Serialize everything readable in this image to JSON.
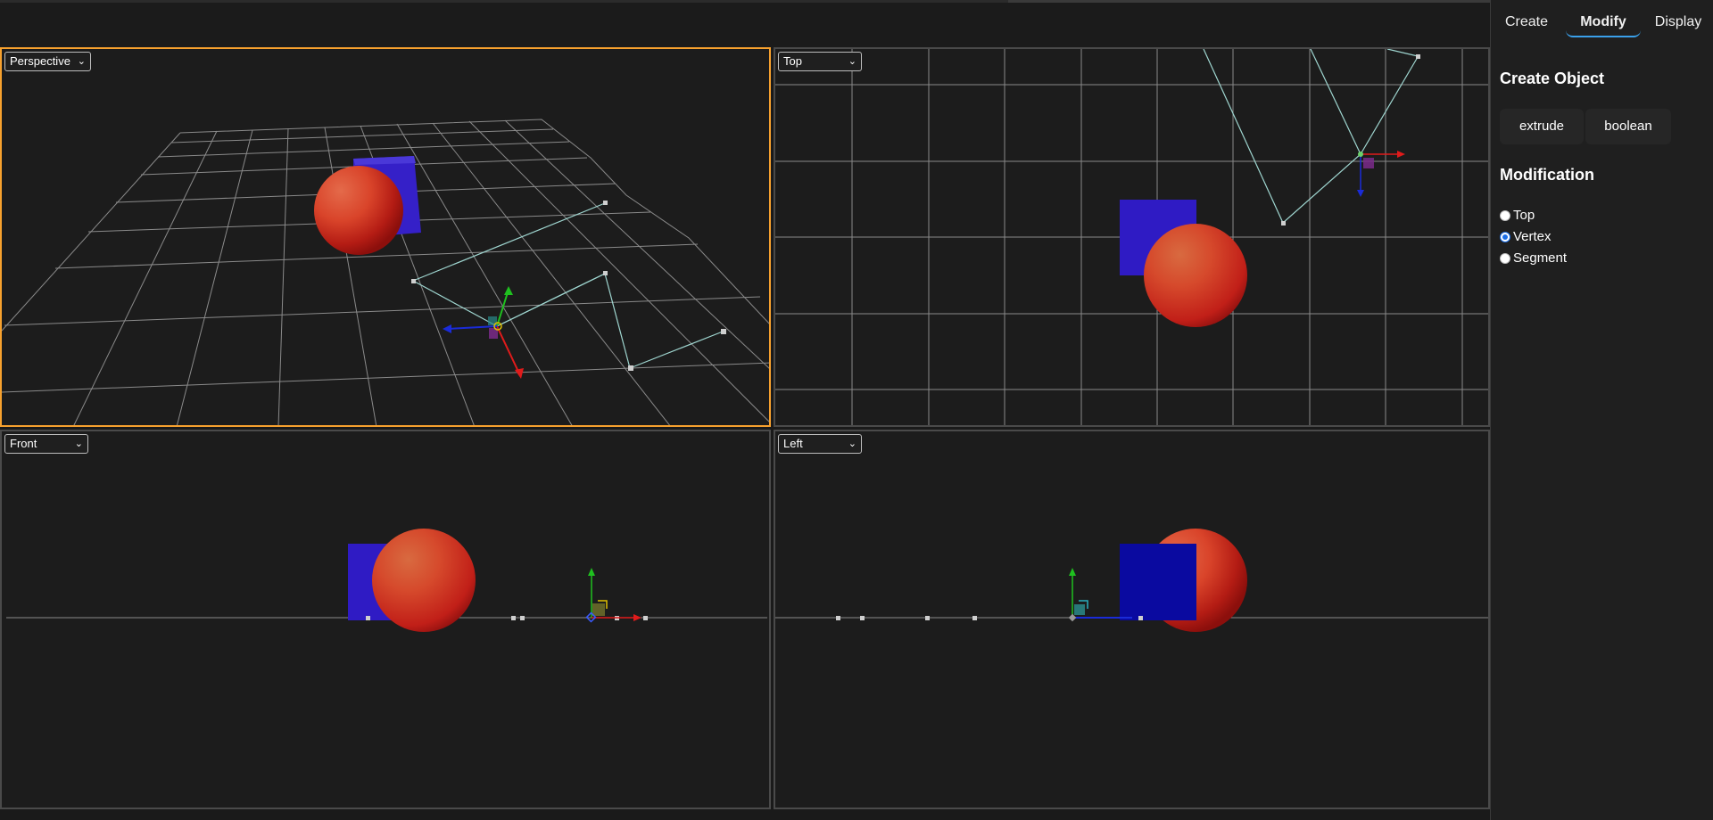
{
  "viewports": {
    "perspective": {
      "label": "Perspective"
    },
    "top": {
      "label": "Top"
    },
    "front": {
      "label": "Front"
    },
    "left": {
      "label": "Left"
    }
  },
  "panel": {
    "tabs": [
      {
        "label": "Create",
        "active": false
      },
      {
        "label": "Modify",
        "active": true
      },
      {
        "label": "Display",
        "active": false
      }
    ],
    "create_object": {
      "title": "Create Object",
      "buttons": [
        "extrude",
        "boolean"
      ]
    },
    "modification": {
      "title": "Modification",
      "options": [
        {
          "label": "Top",
          "selected": false
        },
        {
          "label": "Vertex",
          "selected": true
        },
        {
          "label": "Segment",
          "selected": false
        }
      ]
    }
  },
  "colors": {
    "active_viewport_border": "#f7a12e",
    "active_tab_underline": "#3aa0ea",
    "cube": "#2f1bc4",
    "sphere": "#d9442a",
    "polyline": "#9fd6d0",
    "axis_x": "#e01b1b",
    "axis_y": "#1fc01f",
    "axis_z": "#1a2bd8"
  }
}
